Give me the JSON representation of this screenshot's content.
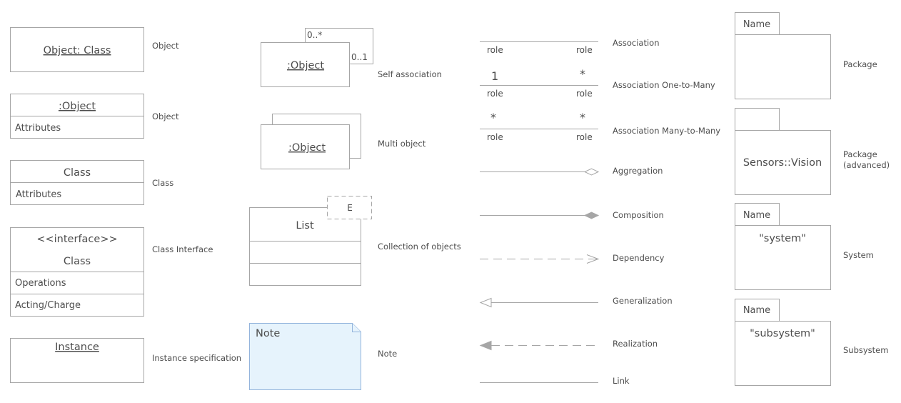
{
  "objects_column": {
    "object_class": {
      "title": "Object: Class",
      "caption": "Object"
    },
    "object_attrs": {
      "title": ":Object",
      "attributes": "Attributes",
      "caption": "Object"
    },
    "class_shape": {
      "title": "Class",
      "attributes": "Attributes",
      "caption": "Class"
    },
    "class_interface": {
      "stereotype": "<<interface>>",
      "title": "Class",
      "operations": "Operations",
      "extra": "Acting/Charge",
      "caption": "Class Interface"
    },
    "instance": {
      "title": "Instance",
      "caption": "Instance specification"
    }
  },
  "second_column": {
    "self_association": {
      "title": ":Object",
      "mult_top": "0..*",
      "mult_right": "0..1",
      "caption": "Self association"
    },
    "multi_object": {
      "title": ":Object",
      "caption": "Multi object"
    },
    "collection": {
      "title": "List",
      "template_param": "E",
      "caption": "Collection of objects"
    },
    "note": {
      "title": "Note",
      "caption": "Note"
    }
  },
  "connectors": {
    "association": {
      "left_role": "role",
      "right_role": "role",
      "caption": "Association"
    },
    "one_to_many": {
      "left_mult": "1",
      "right_mult": "*",
      "left_role": "role",
      "right_role": "role",
      "caption": "Association One-to-Many"
    },
    "many_to_many": {
      "left_mult": "*",
      "right_mult": "*",
      "left_role": "role",
      "right_role": "role",
      "caption": "Association Many-to-Many"
    },
    "aggregation": {
      "caption": "Aggregation"
    },
    "composition": {
      "caption": "Composition"
    },
    "dependency": {
      "caption": "Dependency"
    },
    "generalization": {
      "caption": "Generalization"
    },
    "realization": {
      "caption": "Realization"
    },
    "link": {
      "caption": "Link"
    }
  },
  "packages": {
    "package": {
      "tab": "Name",
      "caption": "Package"
    },
    "package_advanced": {
      "title": "Sensors::Vision",
      "caption_line1": "Package",
      "caption_line2": "(advanced)"
    },
    "system": {
      "tab": "Name",
      "title": "\"system\"",
      "caption": "System"
    },
    "subsystem": {
      "tab": "Name",
      "title": "\"subsystem\"",
      "caption": "Subsystem"
    }
  },
  "colors": {
    "stroke": "#a6a6a6",
    "text": "#4d4d4d",
    "note_fill": "#e6f3fc",
    "note_stroke": "#93b4dc"
  }
}
